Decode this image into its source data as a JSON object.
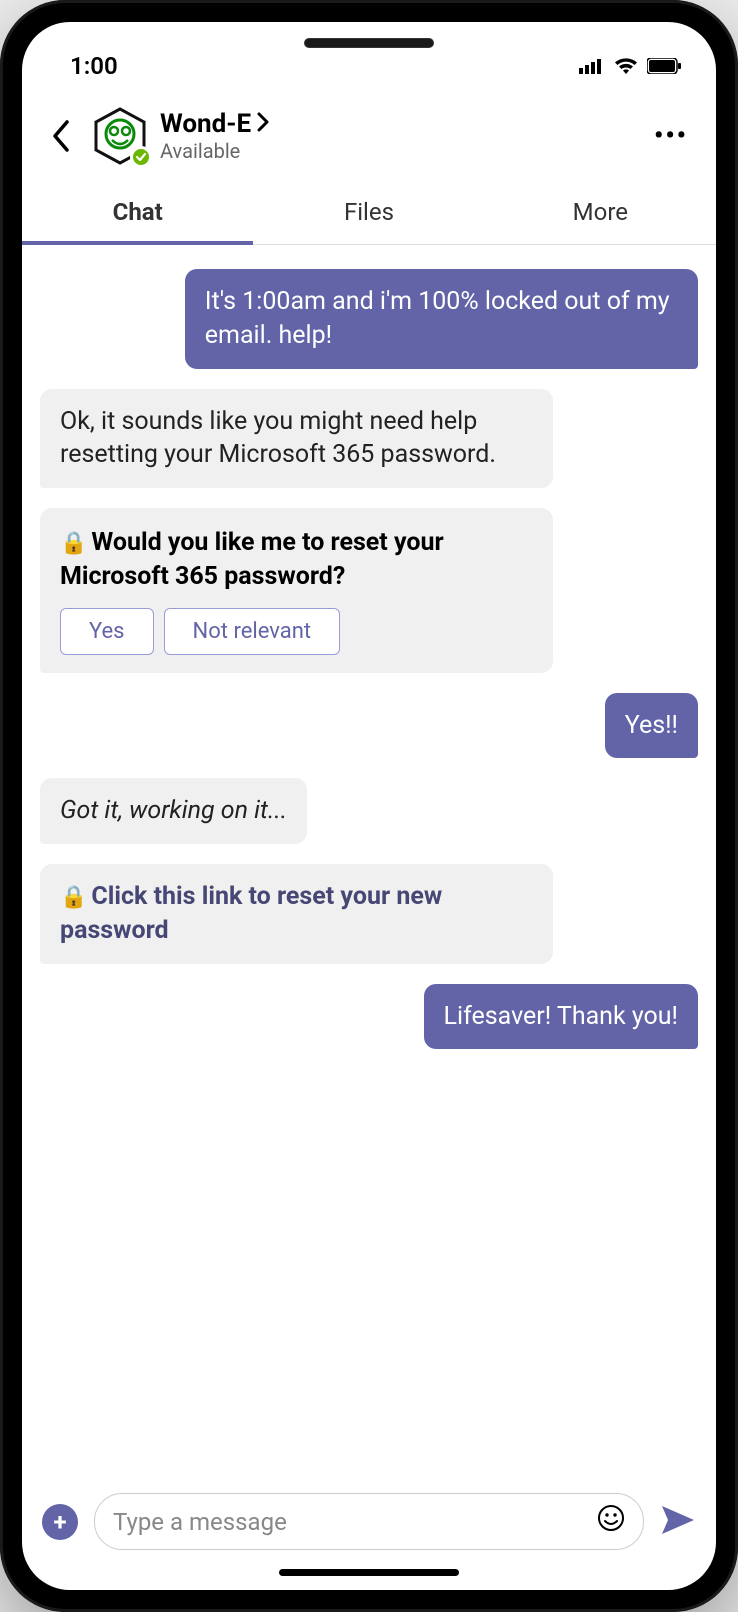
{
  "status_bar": {
    "time": "1:00"
  },
  "header": {
    "title": "Wond-E",
    "subtitle": "Available"
  },
  "tabs": {
    "items": [
      {
        "label": "Chat",
        "active": true
      },
      {
        "label": "Files",
        "active": false
      },
      {
        "label": "More",
        "active": false
      }
    ]
  },
  "messages": {
    "m0": "It's 1:00am and i'm 100% locked out of my email. help!",
    "m1": "Ok, it sounds like you might need help resetting your Microsoft 365 password.",
    "card_title": "Would you like me to reset your Microsoft 365 password?",
    "card_btn_yes": "Yes",
    "card_btn_no": "Not relevant",
    "m2": "Yes!!",
    "m3": "Got it, working on it...",
    "m4": "Click this link to reset your new password",
    "m5": "Lifesaver! Thank you!"
  },
  "composer": {
    "placeholder": "Type a message"
  },
  "colors": {
    "accent": "#6264a7",
    "bubble_received": "#f0f0f0",
    "presence": "#6bb700"
  }
}
